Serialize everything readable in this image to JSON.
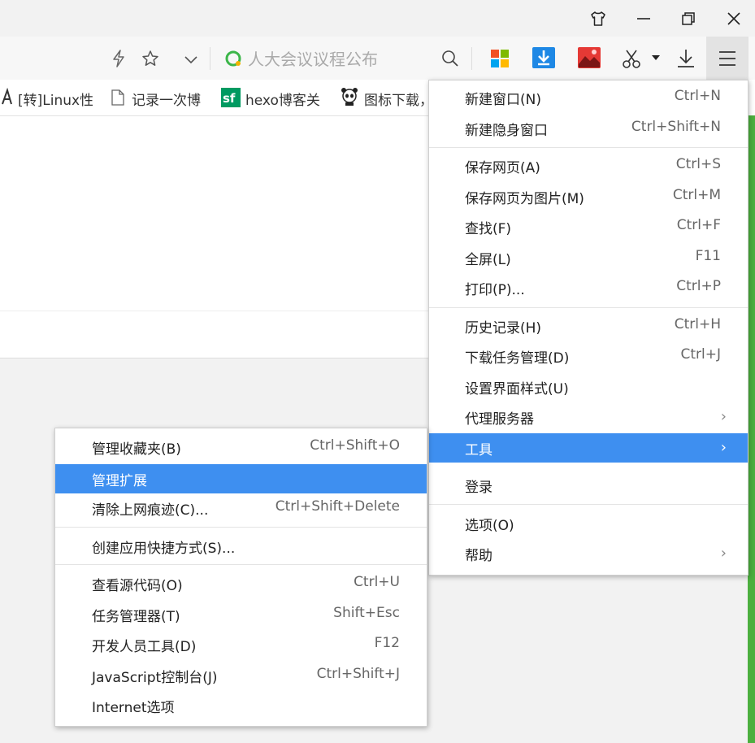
{
  "titlebar": {
    "icons": [
      "skin-icon",
      "minimize-icon",
      "restore-icon",
      "close-icon"
    ]
  },
  "toolbar": {
    "url_placeholder": "人大会议议程公布",
    "icons": [
      "lightning-icon",
      "star-icon",
      "chevron-down-icon",
      "search-icon",
      "apps-icon",
      "download-arrow-icon",
      "image-icon",
      "scissors-icon",
      "caret-down-icon",
      "download-icon",
      "menu-icon"
    ]
  },
  "bookmarks": [
    {
      "label": "[转]Linux性",
      "icon": "bookmark-favicon"
    },
    {
      "label": "记录一次博",
      "icon": "page-icon"
    },
    {
      "label": "hexo博客关",
      "icon": "sf-icon"
    },
    {
      "label": "图标下载，",
      "icon": "panda-icon"
    }
  ],
  "main_menu": {
    "items": [
      {
        "label": "新建窗口(N)",
        "shortcut": "Ctrl+N"
      },
      {
        "label": "新建隐身窗口",
        "shortcut": "Ctrl+Shift+N"
      },
      {
        "label": "保存网页(A)",
        "shortcut": "Ctrl+S"
      },
      {
        "label": "保存网页为图片(M)",
        "shortcut": "Ctrl+M"
      },
      {
        "label": "查找(F)",
        "shortcut": "Ctrl+F"
      },
      {
        "label": "全屏(L)",
        "shortcut": "F11"
      },
      {
        "label": "打印(P)...",
        "shortcut": "Ctrl+P"
      },
      {
        "label": "历史记录(H)",
        "shortcut": "Ctrl+H"
      },
      {
        "label": "下载任务管理(D)",
        "shortcut": "Ctrl+J"
      },
      {
        "label": "设置界面样式(U)",
        "shortcut": ""
      },
      {
        "label": "代理服务器",
        "shortcut": ""
      },
      {
        "label": "工具",
        "shortcut": ""
      },
      {
        "label": "登录",
        "shortcut": ""
      },
      {
        "label": "选项(O)",
        "shortcut": ""
      },
      {
        "label": "帮助",
        "shortcut": ""
      }
    ]
  },
  "tools_submenu": {
    "items": [
      {
        "label": "管理收藏夹(B)",
        "shortcut": "Ctrl+Shift+O"
      },
      {
        "label": "管理扩展",
        "shortcut": ""
      },
      {
        "label": "清除上网痕迹(C)...",
        "shortcut": "Ctrl+Shift+Delete"
      },
      {
        "label": "创建应用快捷方式(S)...",
        "shortcut": ""
      },
      {
        "label": "查看源代码(O)",
        "shortcut": "Ctrl+U"
      },
      {
        "label": "任务管理器(T)",
        "shortcut": "Shift+Esc"
      },
      {
        "label": "开发人员工具(D)",
        "shortcut": "F12"
      },
      {
        "label": "JavaScript控制台(J)",
        "shortcut": "Ctrl+Shift+J"
      },
      {
        "label": "Internet选项",
        "shortcut": ""
      }
    ]
  },
  "colors": {
    "highlight": "#3e8ff0",
    "accent_green": "#4caf3f"
  }
}
